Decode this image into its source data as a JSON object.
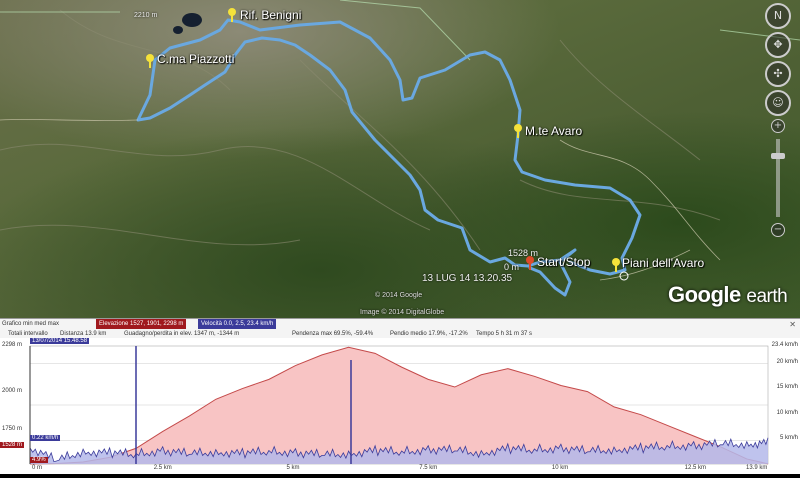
{
  "map": {
    "placemarks": [
      {
        "name": "Rif. Benigni"
      },
      {
        "name": "C.ma Piazzotti"
      },
      {
        "name": "M.te Avaro"
      },
      {
        "name": "Start/Stop"
      },
      {
        "name": "Piani dell'Avaro"
      }
    ],
    "start_elevation": "1528 m",
    "start_distance": "0 m",
    "start_timestamp": "13 LUG 14 13.20.35",
    "top_label": "2210 m",
    "credit_copyright": "© 2014 Google",
    "credit_image": "Image © 2014 DigitalGlobe",
    "logo_primary": "Google",
    "logo_secondary": "earth",
    "nav_north": "N",
    "zoom_in": "+",
    "zoom_out": "−",
    "colors": {
      "track": "#6aa8e0",
      "pin": "#f5e23a",
      "start_pin": "#e04a2a"
    }
  },
  "stats_bar": {
    "graph_label": "Grafico min med max",
    "elevation": "Elevazione 1527, 1901, 2298 m",
    "speed": "Velocità 0.0, 2.5, 23.4 km/h",
    "totals_label": "Totali intervallo",
    "distance": "Distanza 13.9 km",
    "gain_loss": "Guadagno/perdita in elev. 1347 m, -1344 m",
    "max_grade": "Pendenza max 69.5%, -59.4%",
    "avg_grade": "Pendio medio 17.9%, -17.2%",
    "time": "Tempo 5 h 31 m 37 s",
    "close": "✕"
  },
  "profile": {
    "cursor_timestamp": "13/07/2014 15.48.58",
    "cursor_elevation": "1528 m",
    "cursor_speed": "0.22 km/h",
    "cursor_grade": "4.9%",
    "cursor_distance": "0 m",
    "y_left_ticks": [
      "2298 m",
      "2000 m",
      "1750 m",
      "1527 m"
    ],
    "y_right_ticks": [
      "23.4 km/h",
      "20 km/h",
      "15 km/h",
      "10 km/h",
      "5 km/h"
    ],
    "x_ticks": [
      "2.5 km",
      "5 km",
      "7.5 km",
      "10 km",
      "12.5 km",
      "13.9 km"
    ],
    "colors": {
      "elevation": "#c44a4a",
      "elevation_fill": "#f8c4c4",
      "speed": "#3b3b9a",
      "speed_fill": "#b4b8ea"
    }
  },
  "chart_data": {
    "type": "area",
    "x": [
      0,
      0.5,
      1,
      1.5,
      2,
      2.5,
      3,
      3.5,
      4,
      4.5,
      5,
      5.5,
      6,
      6.5,
      7,
      7.5,
      8,
      8.5,
      9,
      9.5,
      10,
      10.5,
      11,
      11.5,
      12,
      12.5,
      13,
      13.5,
      13.9
    ],
    "series": [
      {
        "name": "Elevazione",
        "unit": "m",
        "values": [
          1528,
          1530,
          1540,
          1570,
          1630,
          1740,
          1840,
          1950,
          2020,
          2080,
          2170,
          2240,
          2290,
          2250,
          2160,
          2080,
          2030,
          2110,
          2150,
          2100,
          2040,
          2000,
          1900,
          1850,
          1780,
          1710,
          1640,
          1560,
          1528
        ]
      },
      {
        "name": "Velocità",
        "unit": "km/h",
        "values": [
          3.2,
          0.6,
          2.4,
          2.1,
          1.8,
          2.6,
          1.9,
          2.3,
          2.0,
          2.4,
          2.2,
          1.7,
          2.0,
          2.5,
          2.3,
          2.8,
          2.6,
          2.1,
          2.9,
          2.7,
          3.1,
          2.4,
          2.8,
          3.0,
          3.4,
          3.6,
          3.8,
          3.9,
          4.1
        ]
      }
    ],
    "xlim": [
      0,
      13.9
    ],
    "ylim_left": [
      1527,
      2298
    ],
    "ylim_right": [
      0,
      23.4
    ],
    "grid": true
  }
}
